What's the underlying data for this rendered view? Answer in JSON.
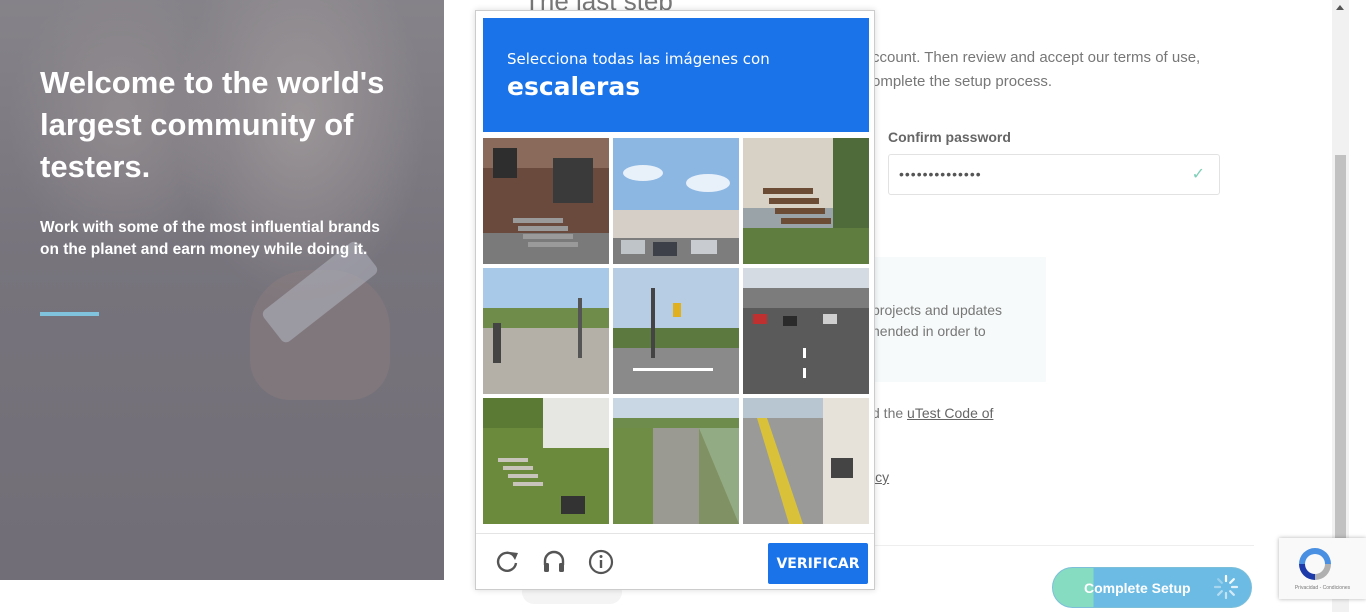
{
  "hero": {
    "heading": "Welcome to the world's largest community of testers.",
    "subheading": "Work with some of the most influential brands on the planet and earn money while doing it."
  },
  "form": {
    "title": "The last step",
    "intro": "ccount. Then review and accept our terms of use, omplete the setup process.",
    "confirm_password_label": "Confirm password",
    "confirm_password_value": "••••••••••••••",
    "updates_text": "projects and updates nended in order to",
    "code_prefix": "d the ",
    "code_link": "uTest Code of",
    "policy_fragment": "icy",
    "complete_button": "Complete Setup"
  },
  "captcha": {
    "prompt": "Selecciona todas las imágenes con",
    "keyword": "escaleras",
    "verify_label": "VERIFICAR",
    "tiles": [
      {
        "desc": "brick-building-stairs"
      },
      {
        "desc": "parking-lot-cars"
      },
      {
        "desc": "wooden-porch-stairs"
      },
      {
        "desc": "road-intersection"
      },
      {
        "desc": "street-traffic-light"
      },
      {
        "desc": "highway-traffic"
      },
      {
        "desc": "house-lawn-steps"
      },
      {
        "desc": "cracked-road"
      },
      {
        "desc": "road-yellow-lines-rv"
      }
    ]
  },
  "recaptcha_badge": {
    "text": "Privacidad - Condiciones"
  },
  "colors": {
    "captcha_blue": "#1a73e8",
    "accent_line": "#7fc4dc",
    "button_green": "#86dcc1",
    "button_blue": "#6cbbe4"
  }
}
